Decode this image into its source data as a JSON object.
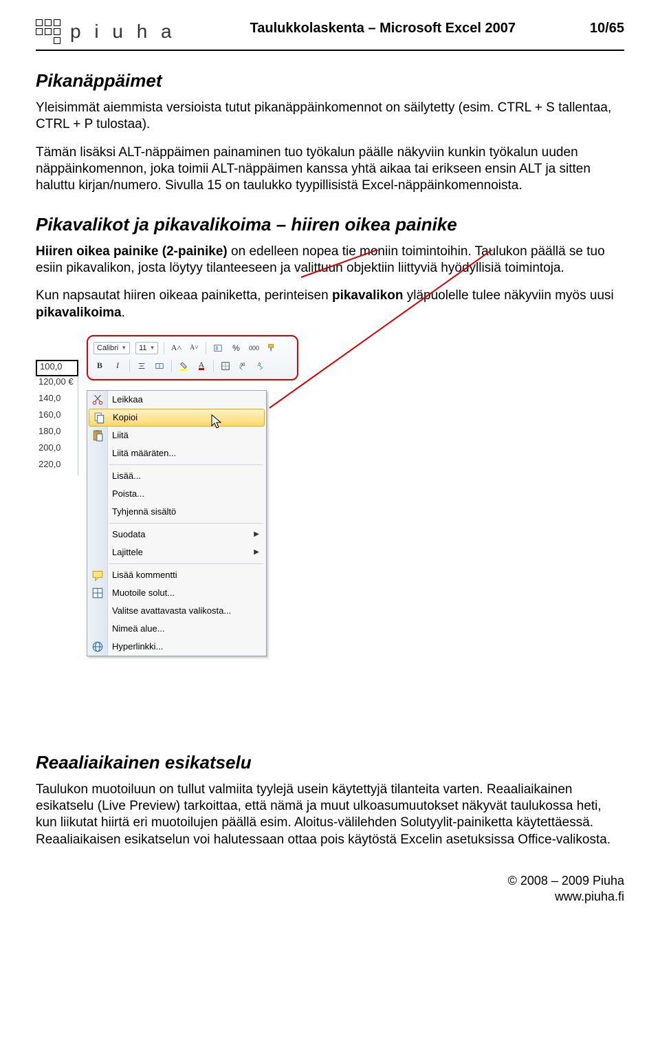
{
  "header": {
    "logo_text": "p i u h a",
    "title": "Taulukkolaskenta – Microsoft Excel 2007",
    "page": "10/65"
  },
  "sections": {
    "shortcuts": {
      "title": "Pikanäppäimet",
      "p_a": "Yleisimmät aiemmista versioista tutut pikanäppäinkomennot on säilytetty (esim. CTRL + S tallentaa, CTRL + P tulostaa).",
      "p_b": "Tämän lisäksi ALT-näppäimen painaminen tuo työkalun päälle näkyviin kunkin työkalun uuden näppäinkomennon, joka toimii ALT-näppäimen kanssa yhtä aikaa tai erikseen ensin ALT ja sitten haluttu kirjan/numero. Sivulla 15 on taulukko tyypillisistä Excel-näppäinkomennoista."
    },
    "contextmenu": {
      "title": "Pikavalikot ja pikavalikoima – hiiren oikea painike",
      "p_a_lead": "Hiiren oikea painike (2-painike)",
      "p_a_rest": " on edelleen nopea tie moniin toimintoihin. Taulukon päällä se tuo esiin pikavalikon, josta löytyy tilanteeseen ja valittuun objektiin liittyviä hyödyllisiä toimintoja.",
      "p_b_a": "Kun napsautat hiiren oikeaa painiketta, perinteisen ",
      "p_b_b": "pikavalikon",
      "p_b_c": " yläpuolelle tulee näkyviin myös uusi ",
      "p_b_d": "pikavalikoima",
      "p_b_e": "."
    },
    "preview": {
      "title": "Reaaliaikainen esikatselu",
      "p": "Taulukon muotoiluun on tullut valmiita tyylejä usein käytettyjä tilanteita varten. Reaaliaikainen esikatselu (Live Preview) tarkoittaa, että nämä ja muut ulkoasumuutokset näkyvät taulukossa heti, kun liikutat hiirtä eri muotoilujen päällä esim. Aloitus-välilehden Solutyylit-painiketta käytettäessä. Reaaliaikaisen esikatselun voi halutessaan ottaa pois käytöstä Excelin asetuksissa Office-valikosta."
    }
  },
  "excel": {
    "rows": [
      "100,0",
      "120,00 €",
      "140,0",
      "160,0",
      "180,0",
      "200,0",
      "220,0"
    ],
    "mini_toolbar": {
      "font_name": "Calibri",
      "font_size": "11",
      "percent": "%",
      "thousands": "000"
    },
    "menu": {
      "cut": "Leikkaa",
      "copy": "Kopioi",
      "paste": "Liitä",
      "paste_special": "Liitä määräten...",
      "insert": "Lisää...",
      "delete": "Poista...",
      "clear": "Tyhjennä sisältö",
      "filter": "Suodata",
      "sort": "Lajittele",
      "comment": "Lisää kommentti",
      "format": "Muotoile solut...",
      "pick": "Valitse avattavasta valikosta...",
      "name": "Nimeä alue...",
      "hyperlink": "Hyperlinkki..."
    }
  },
  "footer": {
    "copyright": "© 2008 – 2009 Piuha",
    "url": "www.piuha.fi"
  }
}
